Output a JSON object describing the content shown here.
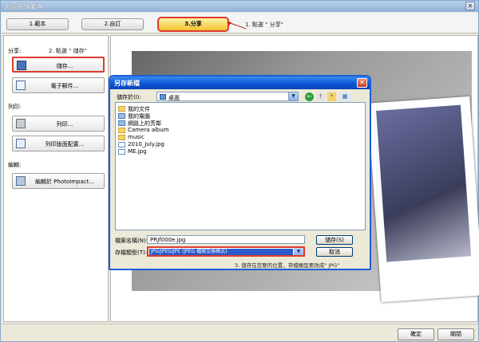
{
  "window": {
    "title": "創意影像範本",
    "close_glyph": "✕"
  },
  "tabs": [
    "1.範本",
    "2.自訂",
    "3.分享"
  ],
  "annotations": {
    "step1": "1. 點選 \" 分享\"",
    "step2": "2. 點選 \" 儲存\"",
    "step3": "3. 儲存在您要的位置，存檔類型要改成\" JPG\""
  },
  "left_panel": {
    "share_heading": "分享:",
    "save_button": "儲存...",
    "email_button": "電子郵件...",
    "print_heading": "列印:",
    "print_button": "列印...",
    "print_layout_button": "列印版面配置...",
    "edit_heading": "編輯:",
    "edit_button": "編輯於 PhotoImpact..."
  },
  "bottom": {
    "ok": "確定",
    "close": "關閉"
  },
  "dialog": {
    "title": "另存新檔",
    "close_glyph": "✕",
    "save_in_label": "儲存於(I):",
    "save_in_value": "桌面",
    "files": [
      {
        "name": "我的文件",
        "icon": "folder-icon"
      },
      {
        "name": "我的電腦",
        "icon": "computer-icon"
      },
      {
        "name": "網路上的芳鄰",
        "icon": "network-icon"
      },
      {
        "name": "Camera album",
        "icon": "folder-icon"
      },
      {
        "name": "music",
        "icon": "folder-icon"
      },
      {
        "name": "2010_July.jpg",
        "icon": "image-file-icon"
      },
      {
        "name": "ME.jpg",
        "icon": "image-file-icon"
      }
    ],
    "filename_label": "檔案名稱(N):",
    "filename_value": "PRJf000e.jpg",
    "filetype_label": "存檔類型(T):",
    "filetype_value": "JPG/JPEG/JPE (JPEG 檔案交換格式)",
    "save_button": "儲存(S)",
    "cancel_button": "取消"
  }
}
